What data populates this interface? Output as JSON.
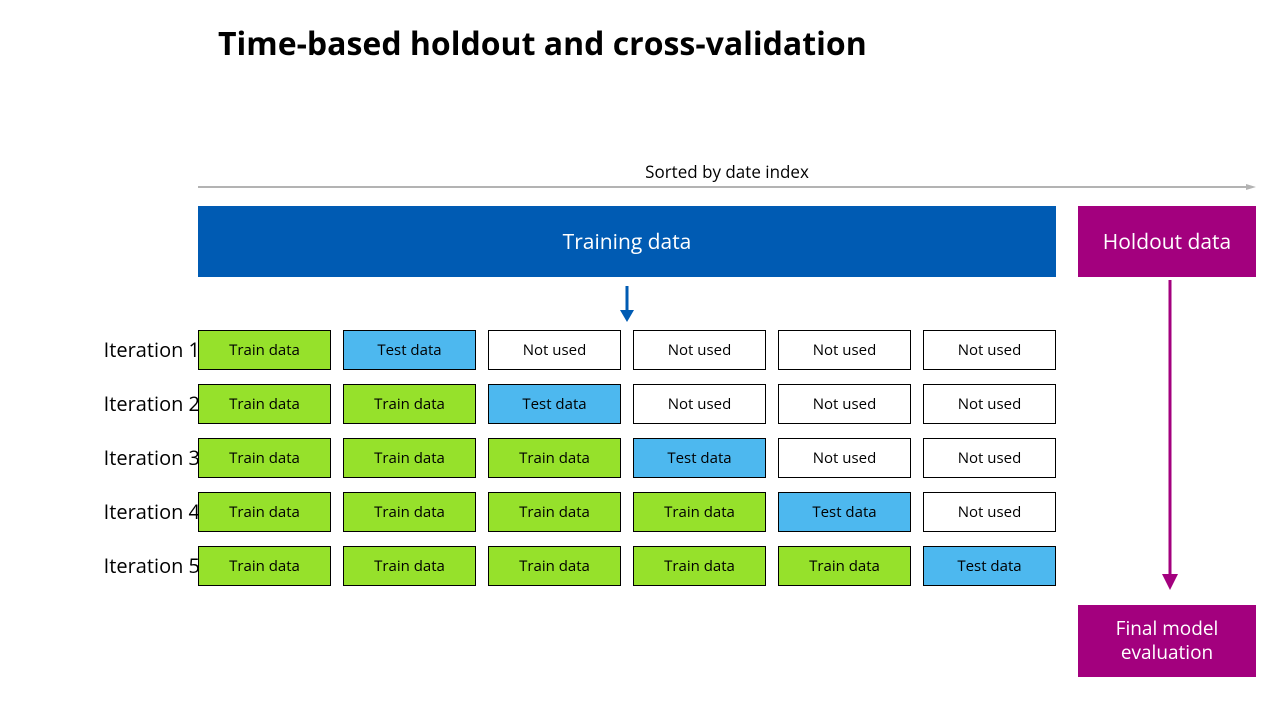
{
  "title": "Time-based holdout and cross-validation",
  "sorted_label": "Sorted by date index",
  "training_label": "Training data",
  "holdout_label": "Holdout data",
  "final_label": "Final model evaluation",
  "iteration_labels": [
    "Iteration 1",
    "Iteration 2",
    "Iteration 3",
    "Iteration 4",
    "Iteration 5"
  ],
  "cell_text": {
    "train": "Train data",
    "test": "Test data",
    "unused": "Not used"
  },
  "colors": {
    "train_bg": "#96e12b",
    "test_bg": "#4db8ef",
    "unused_bg": "#ffffff",
    "training_header": "#005bb3",
    "holdout_header": "#a3007e",
    "arrow_blue": "#005bb3",
    "arrow_magenta": "#a3007e",
    "timeline": "#b3b3b3"
  },
  "grid": [
    [
      "train",
      "test",
      "unused",
      "unused",
      "unused",
      "unused"
    ],
    [
      "train",
      "train",
      "test",
      "unused",
      "unused",
      "unused"
    ],
    [
      "train",
      "train",
      "train",
      "test",
      "unused",
      "unused"
    ],
    [
      "train",
      "train",
      "train",
      "train",
      "test",
      "unused"
    ],
    [
      "train",
      "train",
      "train",
      "train",
      "train",
      "test"
    ]
  ]
}
